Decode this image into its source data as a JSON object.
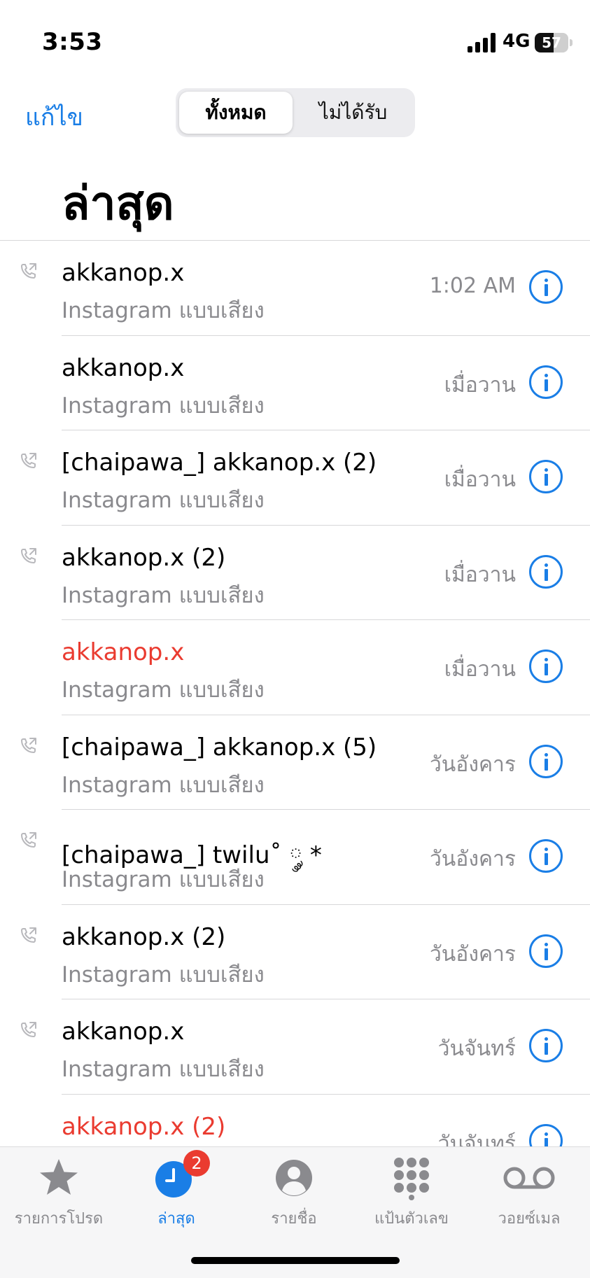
{
  "status": {
    "time": "3:53",
    "network": "4G",
    "battery": "57",
    "battery_level": 0.57
  },
  "nav": {
    "edit_label": "แก้ไข",
    "segments": {
      "all": "ทั้งหมด",
      "missed": "ไม่ได้รับ"
    }
  },
  "title": "ล่าสุด",
  "calls": [
    {
      "name": "akkanop.x",
      "type": "Instagram แบบเสียง",
      "time": "1:02 AM",
      "outgoing": true,
      "missed": false
    },
    {
      "name": "akkanop.x",
      "type": "Instagram แบบเสียง",
      "time": "เมื่อวาน",
      "outgoing": false,
      "missed": false
    },
    {
      "name": "[chaipawa_] akkanop.x (2)",
      "type": "Instagram แบบเสียง",
      "time": "เมื่อวาน",
      "outgoing": true,
      "missed": false
    },
    {
      "name": "akkanop.x (2)",
      "type": "Instagram แบบเสียง",
      "time": "เมื่อวาน",
      "outgoing": true,
      "missed": false
    },
    {
      "name": "akkanop.x",
      "type": "Instagram แบบเสียง",
      "time": "เมื่อวาน",
      "outgoing": false,
      "missed": true
    },
    {
      "name": "[chaipawa_] akkanop.x (5)",
      "type": "Instagram แบบเสียง",
      "time": "วันอังคาร",
      "outgoing": true,
      "missed": false
    },
    {
      "name": "[chaipawa_] twilu˚ ༘ *",
      "type": "Instagram แบบเสียง",
      "time": "วันอังคาร",
      "outgoing": true,
      "missed": false
    },
    {
      "name": "akkanop.x (2)",
      "type": "Instagram แบบเสียง",
      "time": "วันอังคาร",
      "outgoing": true,
      "missed": false
    },
    {
      "name": "akkanop.x",
      "type": "Instagram แบบเสียง",
      "time": "วันจันทร์",
      "outgoing": true,
      "missed": false
    },
    {
      "name": "akkanop.x (2)",
      "type": "",
      "time": "วันจันทร์",
      "outgoing": false,
      "missed": true
    }
  ],
  "tabs": {
    "favorites": {
      "label": "รายการโปรด",
      "icon": "star-icon"
    },
    "recents": {
      "label": "ล่าสุด",
      "icon": "clock-icon",
      "badge": "2"
    },
    "contacts": {
      "label": "รายชื่อ",
      "icon": "person-icon"
    },
    "keypad": {
      "label": "แป้นตัวเลข",
      "icon": "keypad-icon"
    },
    "voicemail": {
      "label": "วอยซ์เมล",
      "icon": "voicemail-icon"
    }
  },
  "colors": {
    "accent": "#1a7ee6",
    "missed": "#ea3b30",
    "secondary": "#8a8a8e"
  }
}
